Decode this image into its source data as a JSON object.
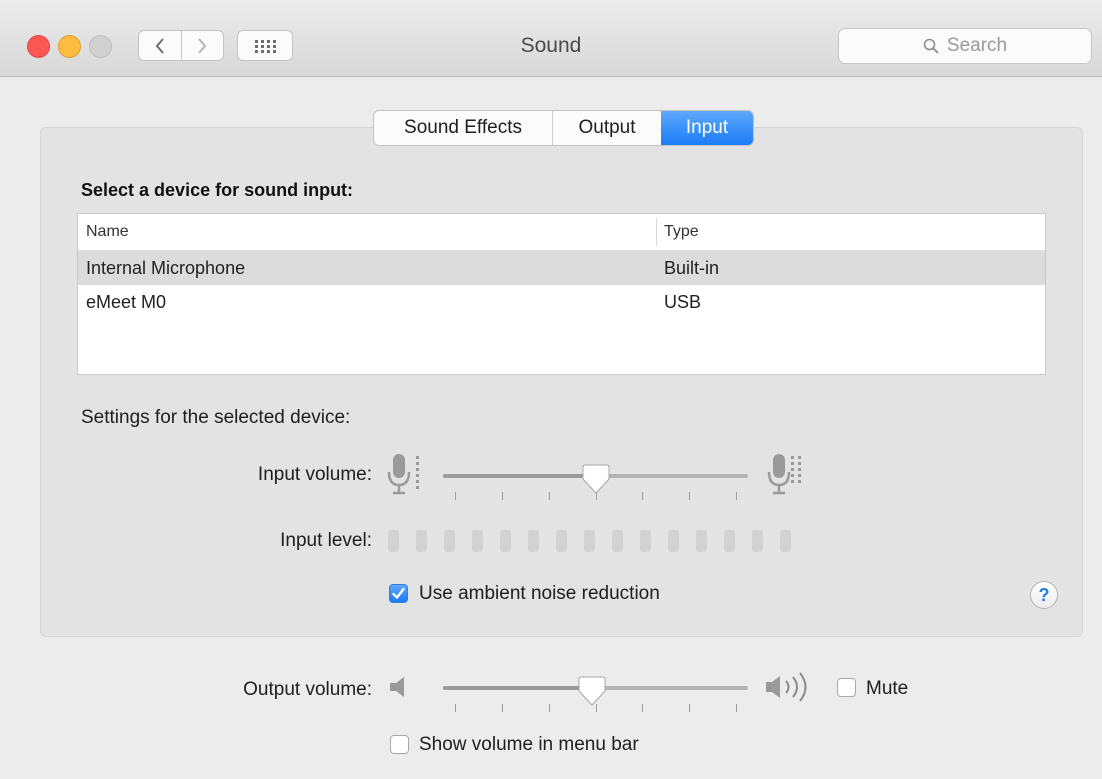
{
  "window": {
    "title": "Sound"
  },
  "toolbar": {
    "back_icon": "chevron-left-icon",
    "forward_icon": "chevron-right-icon",
    "show_all_icon": "grid-icon",
    "search_placeholder": "Search"
  },
  "tabs": [
    {
      "label": "Sound Effects",
      "active": false
    },
    {
      "label": "Output",
      "active": false
    },
    {
      "label": "Input",
      "active": true
    }
  ],
  "input": {
    "select_heading": "Select a device for sound input:",
    "table": {
      "columns": [
        "Name",
        "Type"
      ],
      "rows": [
        {
          "name": "Internal Microphone",
          "type": "Built-in",
          "selected": true
        },
        {
          "name": "eMeet M0",
          "type": "USB",
          "selected": false
        }
      ]
    },
    "settings_heading": "Settings for the selected device:",
    "input_volume_label": "Input volume:",
    "input_volume_value": 0.5,
    "input_level_label": "Input level:",
    "input_level_segments": 15,
    "input_level_value": 0,
    "noise_reduction_label": "Use ambient noise reduction",
    "noise_reduction_checked": true
  },
  "output": {
    "volume_label": "Output volume:",
    "volume_value": 0.49,
    "mute_label": "Mute",
    "mute_checked": false,
    "show_in_menu_bar_label": "Show volume in menu bar",
    "show_in_menu_bar_checked": false
  },
  "help": {
    "label": "?"
  },
  "colors": {
    "accent": "#1b7cf6",
    "close": "#fc5753",
    "minimize": "#fdbc40",
    "zoom": "#d1d1d1"
  }
}
